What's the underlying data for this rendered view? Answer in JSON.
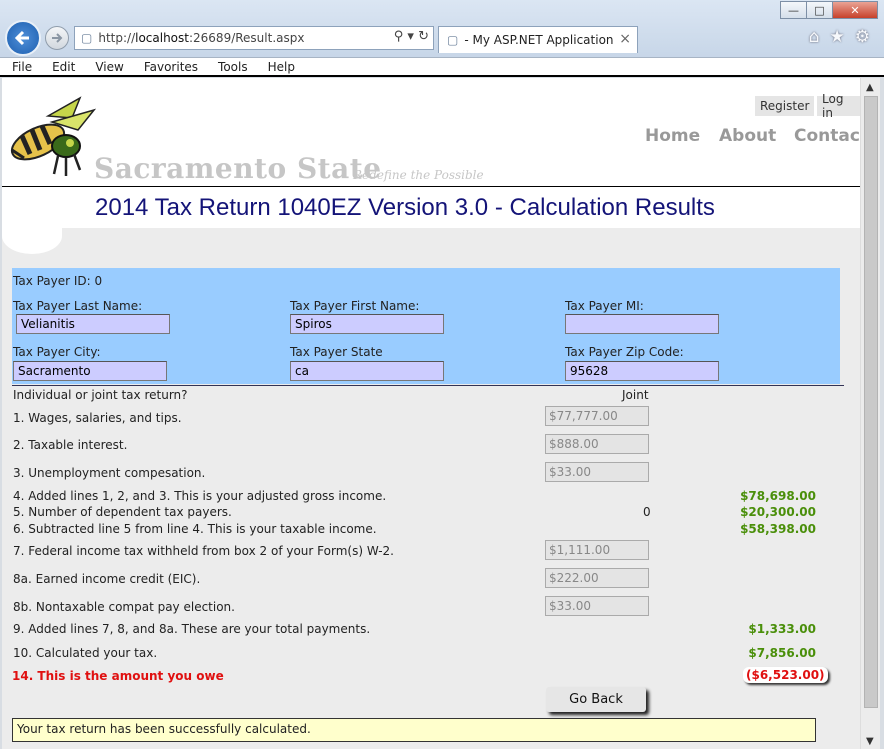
{
  "browser": {
    "url_prefix": "http://",
    "url_host": "localhost",
    "url_rest": ":26689/Result.aspx",
    "tab_title": "- My ASP.NET Application",
    "menu": [
      "File",
      "Edit",
      "View",
      "Favorites",
      "Tools",
      "Help"
    ]
  },
  "site": {
    "name": "Sacramento State",
    "tagline": "Redefine the Possible",
    "register": "Register",
    "login": "Log in",
    "nav": [
      "Home",
      "About",
      "Contact"
    ]
  },
  "page_title": "2014 Tax Return 1040EZ Version 3.0 - Calculation Results",
  "taxpayer": {
    "id_label": "Tax Payer ID: 0",
    "last_name_label": "Tax Payer Last Name:",
    "last_name": "Velianitis",
    "first_name_label": "Tax Payer First Name:",
    "first_name": "Spiros",
    "mi_label": "Tax Payer MI:",
    "mi": "",
    "city_label": "Tax Payer City:",
    "city": "Sacramento",
    "state_label": "Tax Payer State",
    "state": "ca",
    "zip_label": "Tax Payer Zip Code:",
    "zip": "95628"
  },
  "return": {
    "joint_question": "Individual or joint tax return?",
    "joint_value": "Joint",
    "line1_label": "1. Wages, salaries, and tips.",
    "line1_value": "$77,777.00",
    "line2_label": "2. Taxable interest.",
    "line2_value": "$888.00",
    "line3_label": "3. Unemployment compesation.",
    "line3_value": "$33.00",
    "line4_label": "4. Added lines 1, 2, and 3. This is your adjusted gross income.",
    "line4_value": "$78,698.00",
    "line5_label": "5. Number of dependent tax payers.",
    "line5_count": "0",
    "line5_value": "$20,300.00",
    "line6_label": "6. Subtracted line 5 from line 4. This is your taxable income.",
    "line6_value": "$58,398.00",
    "line7_label": "7. Federal income tax withheld from box 2 of your Form(s) W-2.",
    "line7_value": "$1,111.00",
    "line8a_label": "8a. Earned income credit (EIC).",
    "line8a_value": "$222.00",
    "line8b_label": "8b. Nontaxable compat pay election.",
    "line8b_value": "$33.00",
    "line9_label": "9. Added lines 7, 8, and 8a. These are your total payments.",
    "line9_value": "$1,333.00",
    "line10_label": "10. Calculated your tax.",
    "line10_value": "$7,856.00",
    "line14_label": "14. This is the amount you owe",
    "line14_value": "($6,523.00)"
  },
  "go_back": "Go Back",
  "status_message": "Your tax return has been successfully calculated.",
  "colors": {
    "heading": "#141478",
    "panel": "#99ccff",
    "input": "#ccccff",
    "total": "#4a8f0a",
    "owe": "#e01010",
    "status_bg": "#ffffcc"
  }
}
